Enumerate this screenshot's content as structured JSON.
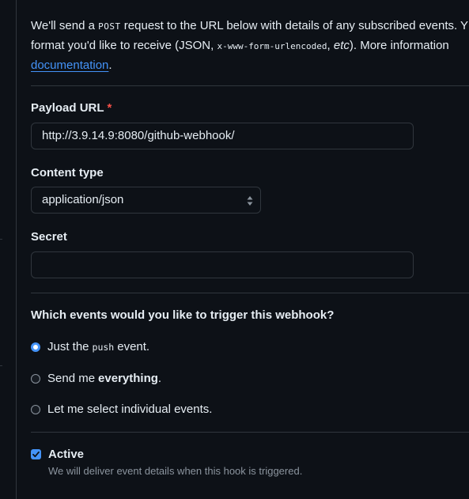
{
  "intro": {
    "text_before_post": "We'll send a ",
    "post_word": "POST",
    "text_after_post": " request to the URL below with details of any subscribed events. Y",
    "line2_before": "format you'd like to receive (JSON, ",
    "line2_code": "x-www-form-urlencoded",
    "line2_sep": ", ",
    "line2_etc": "etc",
    "line2_after": "). More information",
    "link_text": "documentation",
    "line3_after": "."
  },
  "payload_url": {
    "label": "Payload URL",
    "required_mark": "*",
    "value": "http://3.9.14.9:8080/github-webhook/"
  },
  "content_type": {
    "label": "Content type",
    "selected": "application/json"
  },
  "secret": {
    "label": "Secret",
    "value": ""
  },
  "events": {
    "question": "Which events would you like to trigger this webhook?",
    "options": [
      {
        "before": "Just the",
        "code": "push",
        "after": "event.",
        "checked": true
      },
      {
        "before": "Send me",
        "bold": "everything",
        "after": ".",
        "checked": false
      },
      {
        "before": "Let me select individual events.",
        "checked": false
      }
    ]
  },
  "active": {
    "label": "Active",
    "checked": true,
    "hint": "We will deliver event details when this hook is triggered."
  },
  "colors": {
    "background": "#0d1117",
    "border": "#30363d",
    "accent": "#4493f8",
    "required": "#f85149",
    "muted": "#8b949e"
  }
}
